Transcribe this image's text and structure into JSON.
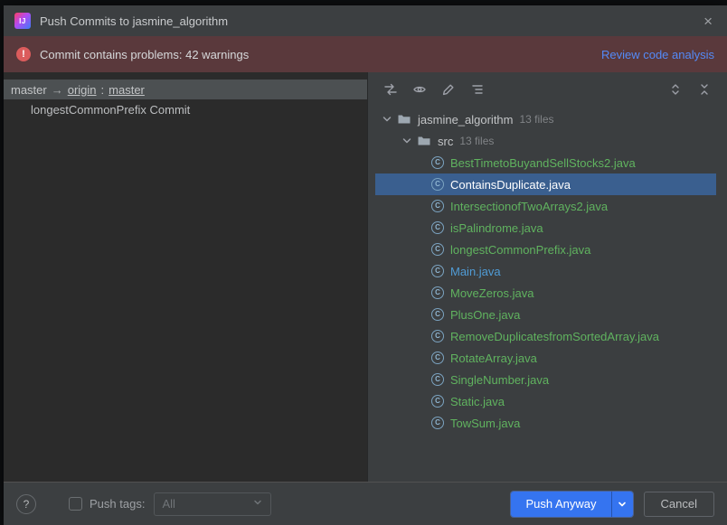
{
  "window": {
    "title": "Push Commits to jasmine_algorithm",
    "logo_glyph": "IJ",
    "close_glyph": "×"
  },
  "banner": {
    "icon_glyph": "!",
    "text": "Commit contains problems: 42 warnings",
    "link": "Review code analysis"
  },
  "commits": {
    "local_branch": "master",
    "arrow": "→",
    "remote": "origin",
    "colon": ":",
    "remote_branch": "master",
    "message": "longestCommonPrefix Commit"
  },
  "files_panel": {
    "toolbar_icons": [
      "swap-arrows",
      "eye",
      "pencil",
      "grouping",
      "expand-all",
      "collapse-all"
    ],
    "root": {
      "name": "jasmine_algorithm",
      "meta": "13 files"
    },
    "src": {
      "name": "src",
      "meta": "13 files"
    },
    "class_icon_glyph": "C",
    "files": [
      {
        "name": "BestTimetoBuyandSellStocks2.java",
        "status": "added",
        "selected": false
      },
      {
        "name": "ContainsDuplicate.java",
        "status": "added",
        "selected": true
      },
      {
        "name": "IntersectionofTwoArrays2.java",
        "status": "added",
        "selected": false
      },
      {
        "name": "isPalindrome.java",
        "status": "added",
        "selected": false
      },
      {
        "name": "longestCommonPrefix.java",
        "status": "added",
        "selected": false
      },
      {
        "name": "Main.java",
        "status": "modified",
        "selected": false
      },
      {
        "name": "MoveZeros.java",
        "status": "added",
        "selected": false
      },
      {
        "name": "PlusOne.java",
        "status": "added",
        "selected": false
      },
      {
        "name": "RemoveDuplicatesfromSortedArray.java",
        "status": "added",
        "selected": false
      },
      {
        "name": "RotateArray.java",
        "status": "added",
        "selected": false
      },
      {
        "name": "SingleNumber.java",
        "status": "added",
        "selected": false
      },
      {
        "name": "Static.java",
        "status": "added",
        "selected": false
      },
      {
        "name": "TowSum.java",
        "status": "added",
        "selected": false
      }
    ]
  },
  "footer": {
    "help_glyph": "?",
    "push_tags_label": "Push tags:",
    "tags_value": "All",
    "push_button": "Push Anyway",
    "cancel_button": "Cancel"
  },
  "colors": {
    "accent": "#3574f0",
    "added": "#60b35f",
    "modified": "#509cd6",
    "selection": "#3a5f8f",
    "banner_background": "#5a393c",
    "link": "#548af7"
  }
}
